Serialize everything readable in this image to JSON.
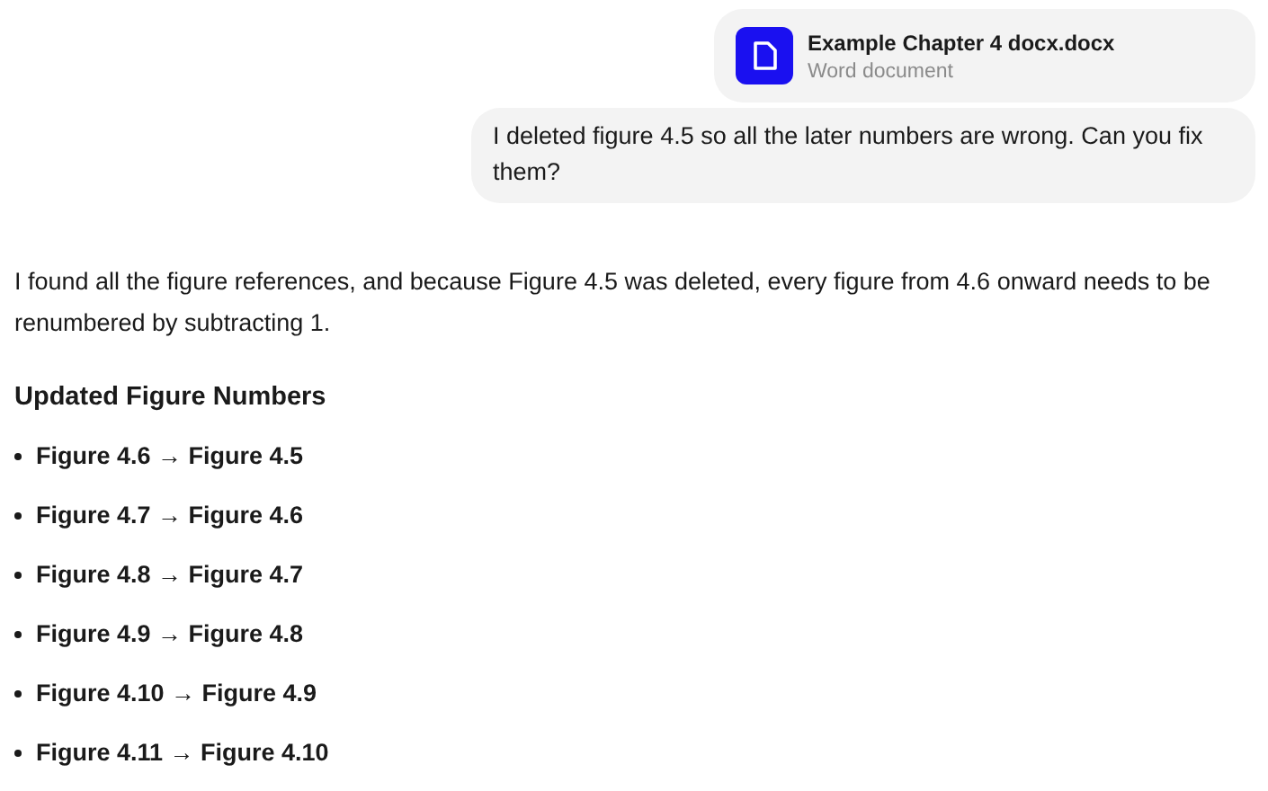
{
  "attachment": {
    "name": "Example Chapter 4 docx.docx",
    "type": "Word document"
  },
  "user_message": "I deleted figure 4.5 so all the later numbers are wrong. Can you fix them?",
  "reply": {
    "intro": "I found all the figure references, and because Figure 4.5 was deleted, every figure from 4.6 onward needs to be renumbered by subtracting 1.",
    "heading": "Updated Figure Numbers",
    "items": [
      "Figure 4.6 → Figure 4.5",
      "Figure 4.7 → Figure 4.6",
      "Figure 4.8 → Figure 4.7",
      "Figure 4.9 → Figure 4.8",
      "Figure 4.10 → Figure 4.9",
      "Figure 4.11 → Figure 4.10"
    ]
  }
}
